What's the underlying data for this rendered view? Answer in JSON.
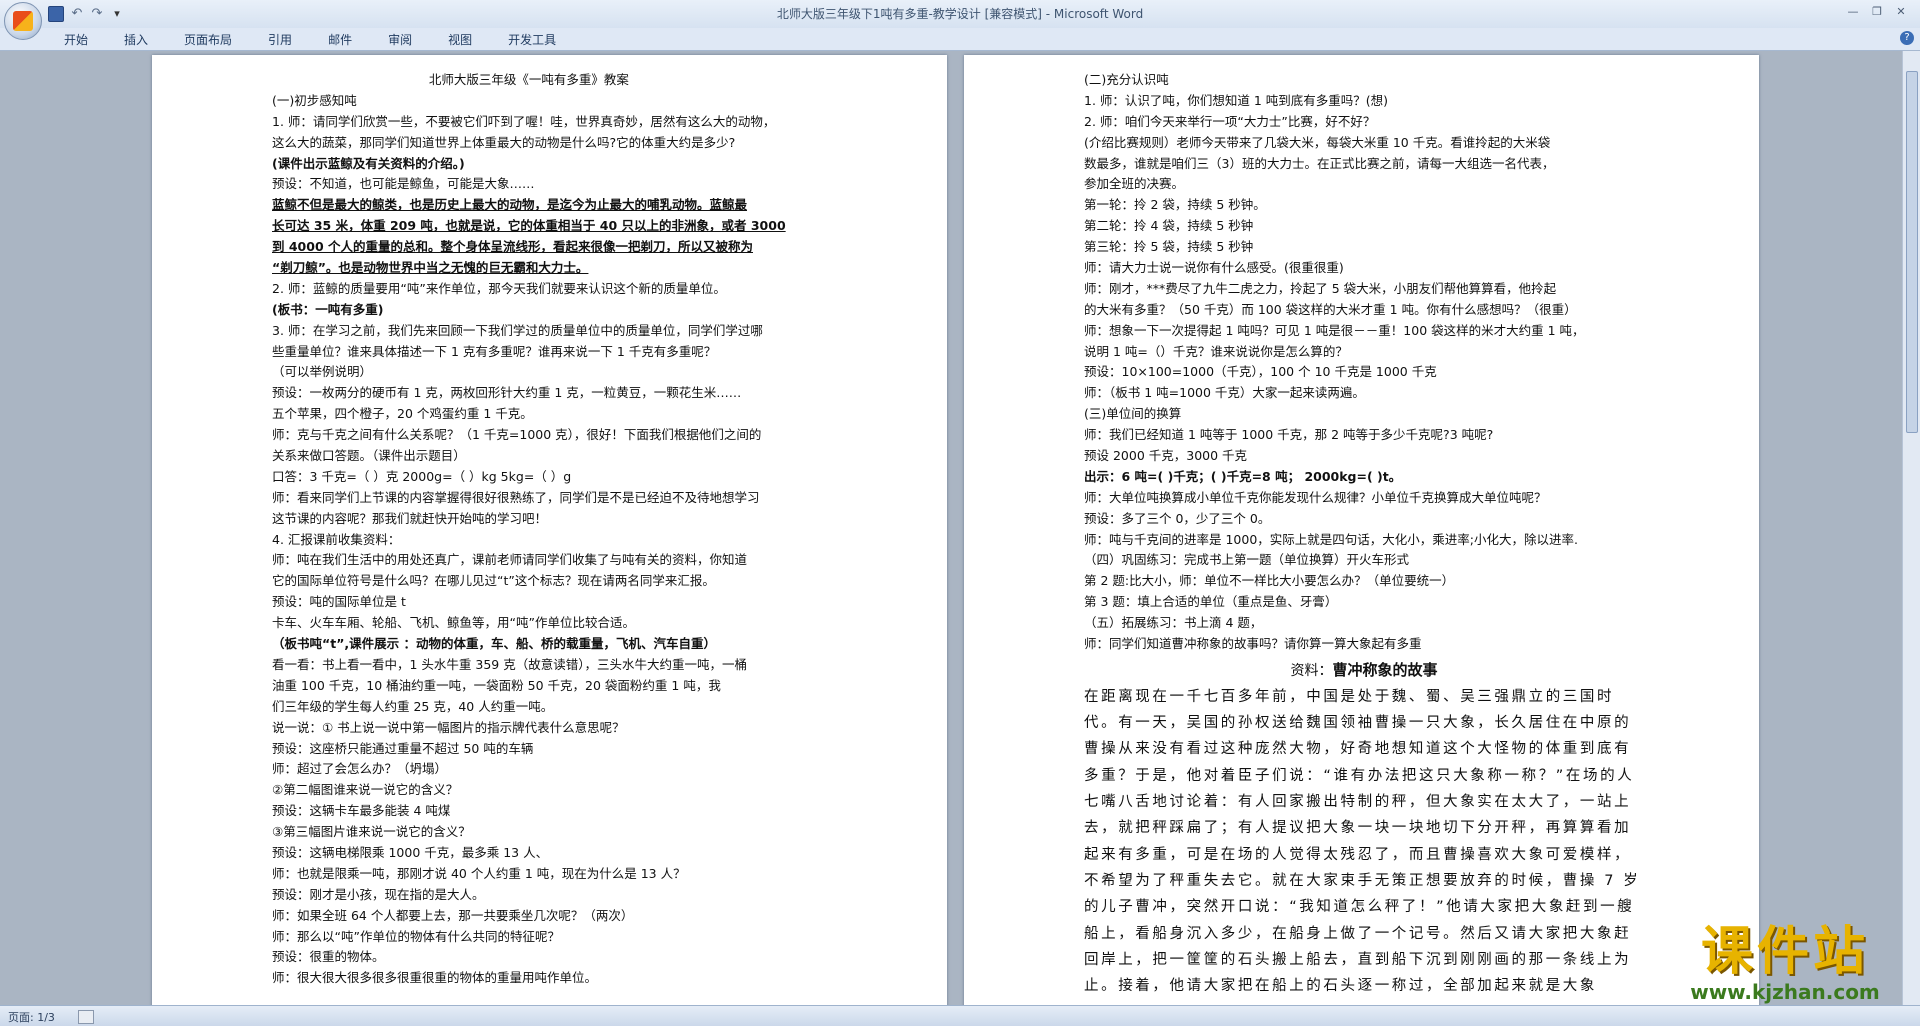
{
  "window": {
    "title": "北师大版三年级下1吨有多重-教学设计 [兼容模式] - Microsoft Word"
  },
  "menu": [
    "开始",
    "插入",
    "页面布局",
    "引用",
    "邮件",
    "审阅",
    "视图",
    "开发工具"
  ],
  "status": {
    "page": "页面: 1/3"
  },
  "watermark": {
    "main": "课件站",
    "url": "www.kjzhan.com"
  },
  "page1": {
    "title": "北师大版三年级《一吨有多重》教案",
    "lines": [
      "(一)初步感知吨",
      "1.  师：请同学们欣赏一些，不要被它们吓到了喔！哇，世界真奇妙，居然有这么大的动物，",
      "     这么大的蔬菜，那同学们知道世界上体重最大的动物是什么吗?它的体重大约是多少?",
      "     (课件出示蓝鲸及有关资料的介绍。)",
      "     预设：不知道，也可能是鲸鱼，可能是大象……",
      "     蓝鲸不但是最大的鲸类，也是历史上最大的动物，是迄今为止最大的哺乳动物。蓝鲸最",
      "     长可达 35 米，体重 209 吨，也就是说，它的体重相当于 40 只以上的非洲象，或者 3000",
      "     到  4000 个人的重量的总和。整个身体呈流线形，看起来很像一把剃刀，所以又被称为",
      "     “剃刀鲸”。也是动物世界中当之无愧的巨无霸和大力士。",
      "2.  师：蓝鲸的质量要用“吨”来作单位，那今天我们就要来认识这个新的质量单位。",
      "     (板书：一吨有多重)",
      "3.  师：在学习之前，我们先来回顾一下我们学过的质量单位中的质量单位，同学们学过哪",
      "     些重量单位？谁来具体描述一下 1 克有多重呢？谁再来说一下 1 千克有多重呢？",
      "     （可以举例说明）",
      "          预设：一枚两分的硬币有 1 克，两枚回形针大约重 1 克，一粒黄豆，一颗花生米……",
      "          五个苹果，四个橙子，20 个鸡蛋约重 1 千克。",
      "     师：克与千克之间有什么关系呢？（1 千克=1000 克），很好！下面我们根据他们之间的",
      "          关系来做口答题。（课件出示题目）",
      "     口答：3 千克=（          ）克          2000g=（          ）kg              5kg=（          ）g",
      "    师：看来同学们上节课的内容掌握得很好很熟练了，同学们是不是已经迫不及待地想学习",
      "          这节课的内容呢？那我们就赶快开始吨的学习吧！",
      "4.  汇报课前收集资料：",
      "     师：吨在我们生活中的用处还真广，课前老师请同学们收集了与吨有关的资料，你知道",
      "          它的国际单位符号是什么吗？在哪儿见过“t”这个标志？现在请两名同学来汇报。",
      "          预设：吨的国际单位是 t",
      "          卡车、火车车厢、轮船、飞机、鲸鱼等，用“吨”作单位比较合适。",
      "      （板书吨“t”,课件展示 ：动物的体重，车、船、桥的载重量，飞机、汽车自重）",
      "       看一看：书上看一看中，1 头水牛重 359 克（故意读错），三头水牛大约重一吨，一桶",
      "          油重 100 千克，10 桶油约重一吨，一袋面粉 50 千克，20 袋面粉约重 1 吨，我",
      "          们三年级的学生每人约重 25 克，40 人约重一吨。",
      "       说一说：① 书上说一说中第一幅图片的指示牌代表什么意思呢？",
      "                    预设：这座桥只能通过重量不超过 50 吨的车辆",
      "                         师：超过了会怎么办？（坍塌）",
      "                 ②第二幅图谁来说一说它的含义？",
      "                    预设：这辆卡车最多能装 4 吨煤",
      "                 ③第三幅图片谁来说一说它的含义？",
      "                    预设：这辆电梯限乘 1000 千克，最多乘 13 人、",
      "                    师：也就是限乘一吨，那刚才说 40 个人约重 1 吨，现在为什么是 13 人？",
      "                    预设：刚才是小孩，现在指的是大人。",
      "                    师：如果全班 64 个人都要上去，那一共要乘坐几次呢？（两次）",
      "     师：那么以“吨”作单位的物体有什么共同的特征呢？",
      "          预设：很重的物体。",
      "     师：很大很大很多很多很重很重的物体的重量用吨作单位。"
    ]
  },
  "page2": {
    "lines": [
      "(二)充分认识吨",
      "1.  师：认识了吨，你们想知道 1 吨到底有多重吗？(想)",
      "2.  师：咱们今天来举行一项“大力士”比赛，好不好？",
      "     (介绍比赛规则）老师今天带来了几袋大米，每袋大米重 10 千克。看谁拎起的大米袋",
      "     数最多，谁就是咱们三（3）班的大力士。在正式比赛之前，请每一大组选一名代表，",
      "     参加全班的决赛。",
      "     第一轮：拎 2 袋，持续 5 秒钟。",
      "     第二轮：拎 4 袋，持续 5 秒钟",
      "     第三轮：拎 5 袋，持续 5 秒钟",
      "     师：请大力士说一说你有什么感受。(很重很重)",
      "     师：刚才，***费尽了九牛二虎之力，拎起了 5 袋大米，小朋友们帮他算算看，他拎起",
      "     的大米有多重？（50 千克）而 100 袋这样的大米才重 1 吨。你有什么感想吗？（很重）",
      "     师：想象一下一次提得起 1 吨吗？可见 1 吨是很－－重！100 袋这样的米才大约重 1 吨，",
      "     说明 1 吨=（）千克？谁来说说你是怎么算的？",
      "     预设：10×100=1000（千克），100 个 10 千克是 1000 千克",
      "     师：（板书 1 吨=1000 千克）大家一起来读两遍。",
      "(三)单位间的换算",
      "师：我们已经知道 1 吨等于 1000 千克，那 2 吨等于多少千克呢?3 吨呢?",
      "     预设 2000 千克，3000 千克",
      "   出示：6 吨=(      )千克；(      )千克=8 吨；  2000kg=(      )t。",
      "师：大单位吨换算成小单位千克你能发现什么规律？小单位千克换算成大单位吨呢？",
      "预设：多了三个 0，少了三个 0。",
      "师：吨与千克间的进率是  1000，实际上就是四句话，大化小，乘进率;小化大，除以进率.",
      "（四）巩固练习：完成书上第一题（单位换算）开火车形式",
      "                    第 2 题:比大小，师：单位不一样比大小要怎么办？（单位要统一）",
      "                    第 3 题：填上合适的单位（重点是鱼、牙膏）",
      "（五）拓展练习：书上滴 4 题，",
      "        师：同学们知道曹冲称象的故事吗？请你算一算大象起有多重"
    ],
    "story_label": "资料：",
    "story_title": "曹冲称象的故事",
    "story": "在距离现在一千七百多年前，中国是处于魏、蜀、吴三强鼎立的三国时代。有一天，吴国的孙权送给魏国领袖曹操一只大象，长久居住在中原的曹操从来没有看过这种庞然大物，好奇地想知道这个大怪物的体重到底有多重？于是，他对着臣子们说：“谁有办法把这只大象称一称？”在场的人七嘴八舌地讨论着：有人回家搬出特制的秤，但大象实在太大了，一站上去，就把秤踩扁了；有人提议把大象一块一块地切下分开秤，再算算看加起来有多重，可是在场的人觉得太残忍了，而且曹操喜欢大象可爱模样，不希望为了秤重失去它。就在大家束手无策正想要放弃的时候，曹操 7 岁的儿子曹冲，突然开口说：“我知道怎么秤了！”他请大家把大象赶到一艘船上，看船身沉入多少，在船身上做了一个记号。然后又请大家把大象赶回岸上，把一筐筐的石头搬上船去，直到船下沉到刚刚画的那一条线上为止。接着，他请大家把在船上的石头逐一称过，全部加起来就是大象"
  }
}
